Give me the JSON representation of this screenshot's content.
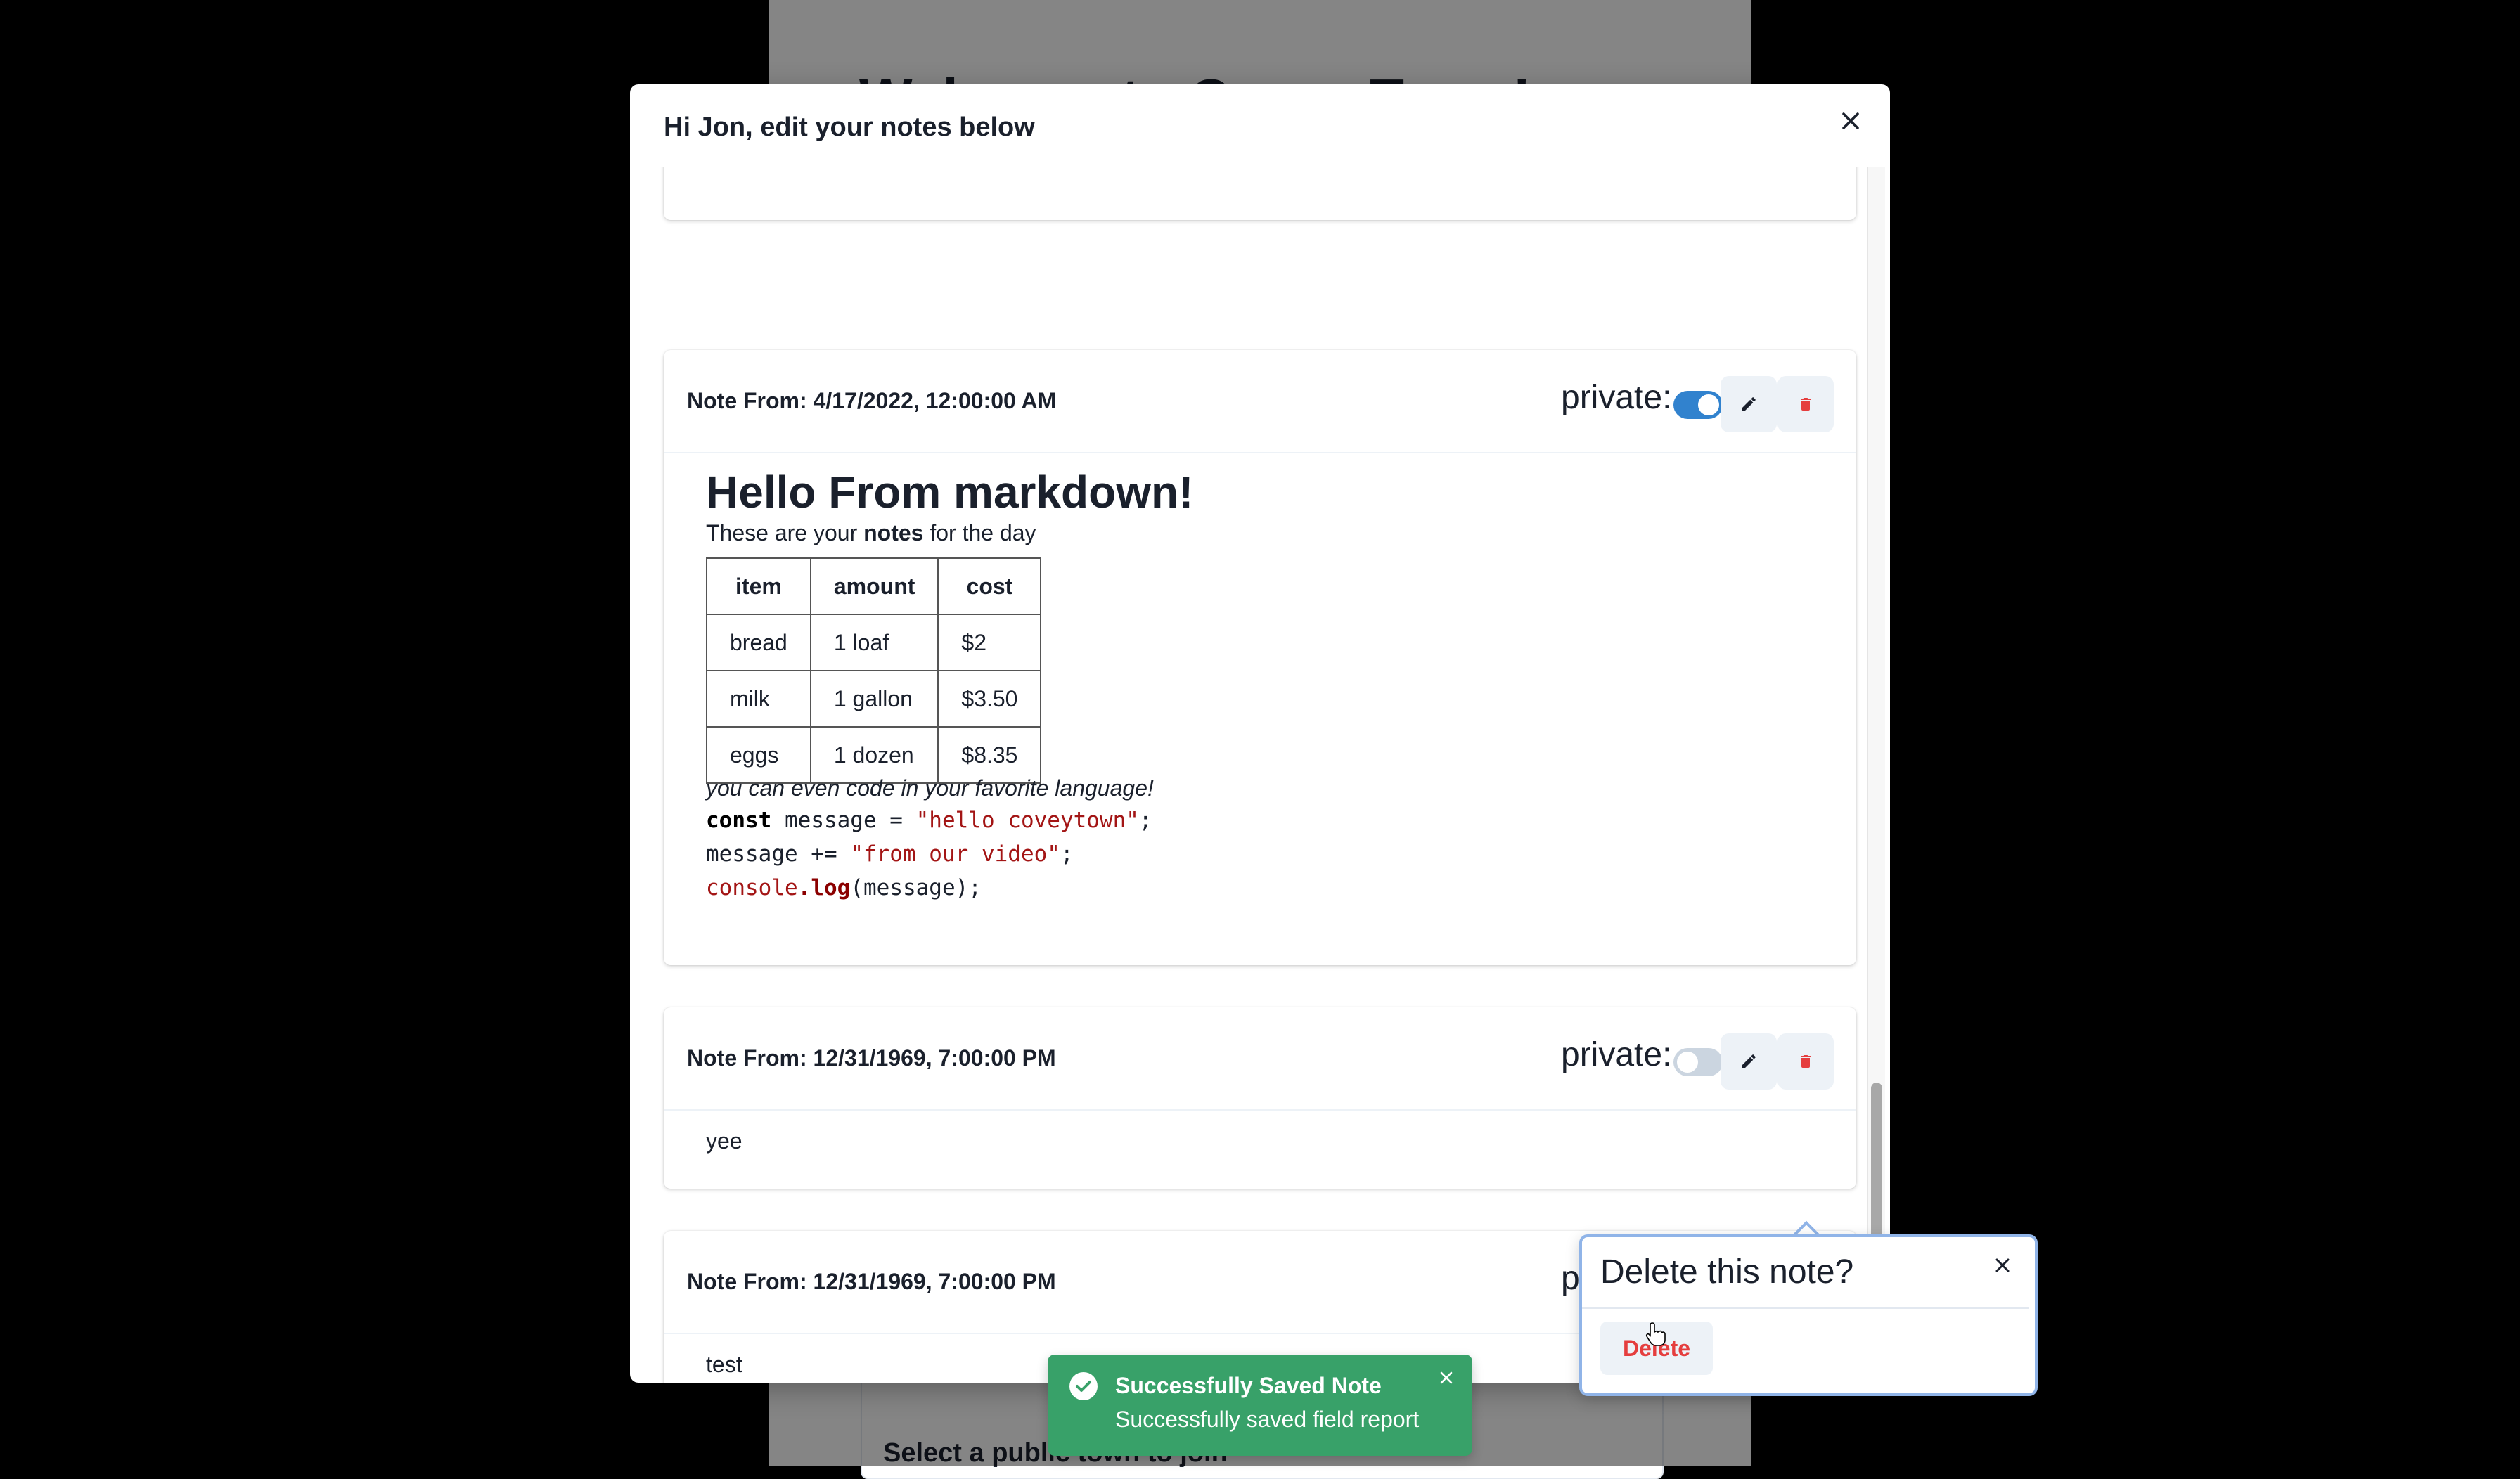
{
  "background": {
    "heading": "Welcome to Covey.Town!",
    "subheading": "Select a public town to join"
  },
  "modal": {
    "title": "Hi Jon, edit your notes below",
    "close_icon": "close-icon",
    "private_label": "private:",
    "notes": [
      {
        "title": "Note From: 4/17/2022, 12:00:00 AM",
        "private": true,
        "markdown": {
          "heading": "Hello From markdown!",
          "paragraph_before": "These are your ",
          "paragraph_bold": "notes",
          "paragraph_after": " for the day",
          "table": {
            "headers": [
              "item",
              "amount",
              "cost"
            ],
            "rows": [
              [
                "bread",
                "1 loaf",
                "$2"
              ],
              [
                "milk",
                "1 gallon",
                "$3.50"
              ],
              [
                "eggs",
                "1 dozen",
                "$8.35"
              ]
            ]
          },
          "italic": "you can even code in your favorite language!",
          "code": {
            "line1_kw": "const",
            "line1_mid": " message = ",
            "line1_str": "\"hello coveytown\"",
            "line1_end": ";",
            "line2_mid": "message += ",
            "line2_str": "\"from our video\"",
            "line2_end": ";",
            "line3_obj": "console",
            "line3_dot": ".",
            "line3_fn": "log",
            "line3_end": "(message);"
          }
        }
      },
      {
        "title": "Note From: 12/31/1969, 7:00:00 PM",
        "private": false,
        "text": "yee"
      },
      {
        "title": "Note From: 12/31/1969, 7:00:00 PM",
        "private": false,
        "text": "test"
      }
    ]
  },
  "popover": {
    "title": "Delete this note?",
    "delete_label": "Delete"
  },
  "toast": {
    "title": "Successfully Saved Note",
    "description": "Successfully saved field report",
    "status_color": "#38a169"
  },
  "colors": {
    "toggle_on": "#3182ce",
    "toggle_off": "#cbd5e0",
    "delete_red": "#e53e3e"
  }
}
